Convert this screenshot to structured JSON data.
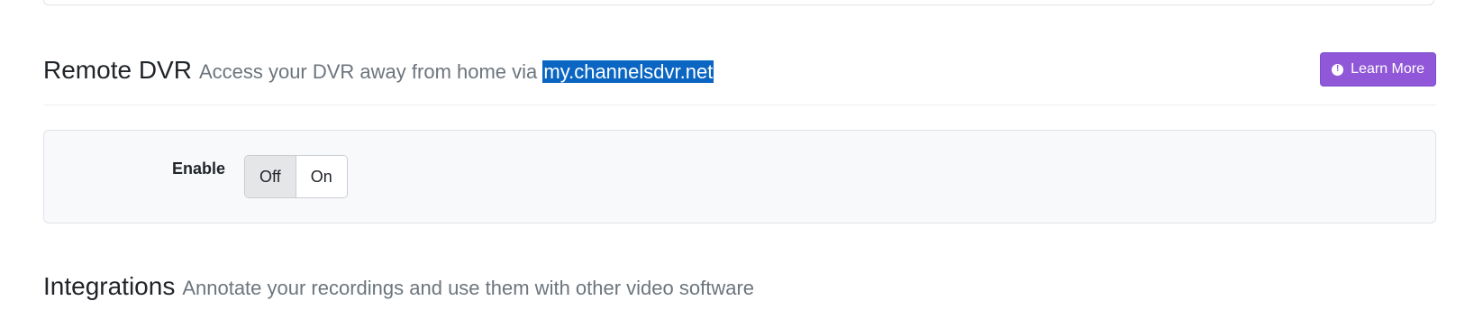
{
  "remote_dvr": {
    "title": "Remote DVR",
    "subtitle_prefix": "Access your DVR away from home via ",
    "subtitle_link": "my.channelsdvr.net",
    "learn_more_label": "Learn More",
    "learn_more_icon": "info-circle-icon",
    "accent_color": "#9057d8"
  },
  "settings": {
    "enable_label": "Enable",
    "toggle_options": [
      "Off",
      "On"
    ],
    "selected": "Off"
  },
  "integrations": {
    "title": "Integrations",
    "subtitle": "Annotate your recordings and use them with other video software"
  }
}
